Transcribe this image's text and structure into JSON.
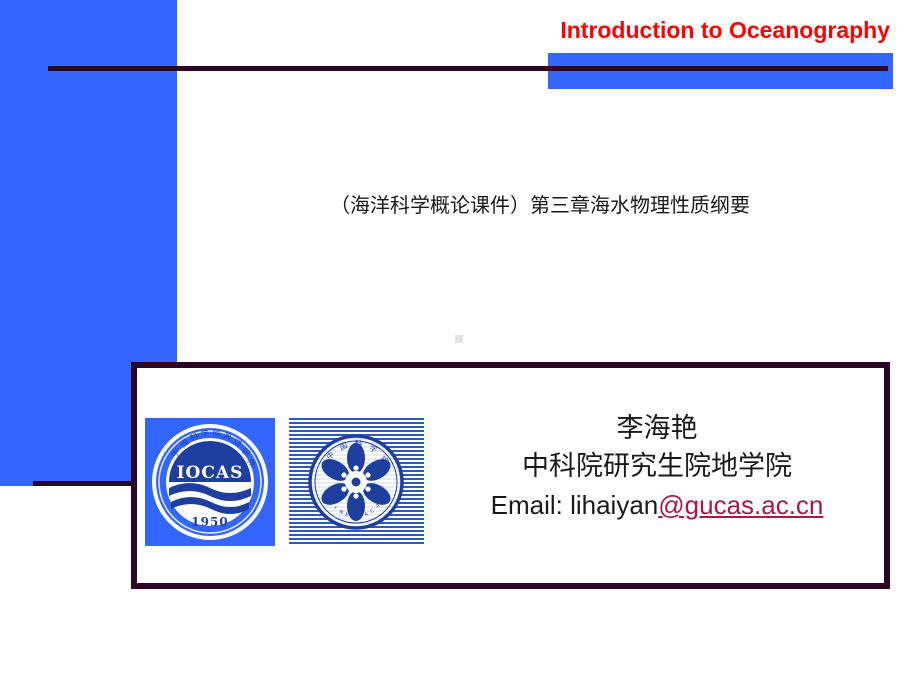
{
  "slide": {
    "header_title": "Introduction to Oceanography",
    "course_title": "（海洋科学概论课件）第三章海水物理性质纲要",
    "author": {
      "name": "李海艳",
      "affiliation": "中科院研究生院地学院",
      "email_label": "Email: lihaiyan",
      "email_link": "@gucas.ac.cn"
    },
    "logos": [
      {
        "id": "iocas-logo",
        "acronym": "IOCAS",
        "year": "1950",
        "ring_text": "中国科学院海洋研究所"
      },
      {
        "id": "cas-logo",
        "ring_text_top": "中国科学院",
        "ring_text_bottom": "CHINESE ACADEMY OF SCIENCES"
      }
    ]
  },
  "colors": {
    "accent_blue": "#3366ff",
    "rule_purple": "#2d0526",
    "title_red": "#ff0000",
    "link_crimson": "#a8194a",
    "logo_blue": "#1f3f9e",
    "background": "#ffffff"
  }
}
